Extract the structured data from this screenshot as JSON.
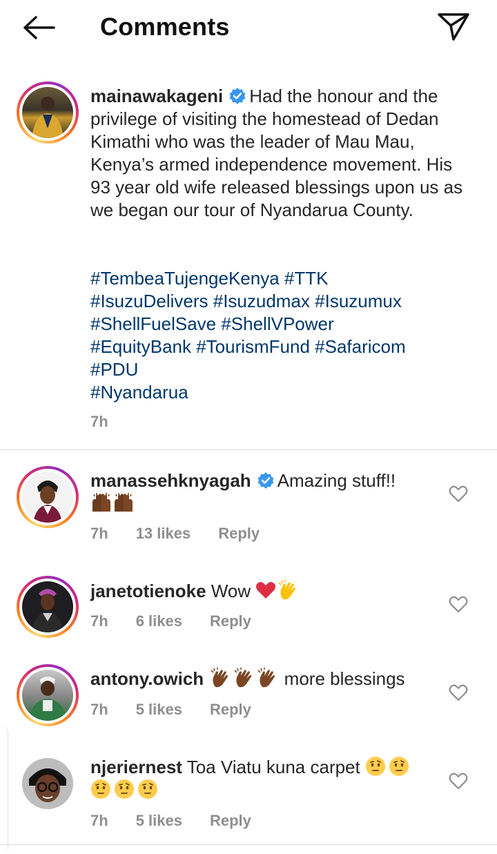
{
  "header": {
    "title": "Comments"
  },
  "caption": {
    "username": "mainawakageni",
    "verified": true,
    "text": "Had the honour and the privilege of visiting the homestead of Dedan Kimathi who was the leader of Mau Mau, Kenya’s armed independence movement. His 93 year old wife released blessings upon us as we began our tour of Nyandarua County.",
    "hashtag_lines": [
      "#TembeaTujengeKenya #TTK",
      "#IsuzuDelivers #Isuzudmax #Isuzumux",
      "#ShellFuelSave #ShellVPower",
      "#EquityBank #TourismFund #Safaricom",
      "#PDU",
      "#Nyandarua"
    ],
    "time": "7h"
  },
  "comments": [
    {
      "username": "manassehknyagah",
      "verified": true,
      "text": "Amazing stuff!!",
      "time": "7h",
      "likes": "13 likes",
      "reply": "Reply"
    },
    {
      "username": "janetotienoke",
      "verified": false,
      "text": "Wow",
      "time": "7h",
      "likes": "6 likes",
      "reply": "Reply"
    },
    {
      "username": "antony.owich",
      "verified": false,
      "text": "more blessings",
      "time": "7h",
      "likes": "5 likes",
      "reply": "Reply"
    },
    {
      "username": "njeriernest",
      "verified": false,
      "text": "Toa Viatu kuna carpet",
      "time": "7h",
      "likes": "5 likes",
      "reply": "Reply"
    }
  ],
  "icons": {
    "back": "arrow-left-icon",
    "send": "paper-plane-icon",
    "verified": "verified-badge-icon",
    "like": "heart-outline-icon"
  },
  "colors": {
    "hashtag": "#00376b",
    "verified": "#3897f0",
    "meta": "#8e8e8e"
  }
}
